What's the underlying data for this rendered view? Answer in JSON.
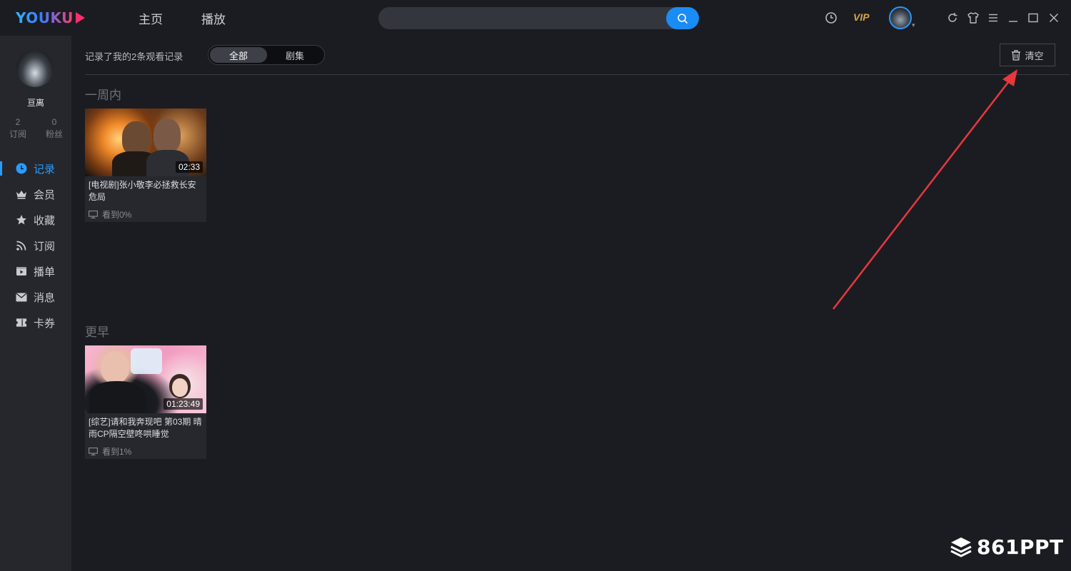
{
  "app": {
    "logo": "YOUKU"
  },
  "topbar": {
    "nav": [
      "主页",
      "播放"
    ],
    "search": {
      "placeholder": "",
      "value": ""
    },
    "vip_label": "VIP"
  },
  "sidebar": {
    "username": "亘离",
    "stats": [
      {
        "value": "2",
        "label": "订阅"
      },
      {
        "value": "0",
        "label": "粉丝"
      }
    ],
    "items": [
      {
        "label": "记录",
        "icon": "clock-icon",
        "active": true
      },
      {
        "label": "会员",
        "icon": "crown-icon"
      },
      {
        "label": "收藏",
        "icon": "star-icon"
      },
      {
        "label": "订阅",
        "icon": "rss-icon"
      },
      {
        "label": "播单",
        "icon": "playlist-icon"
      },
      {
        "label": "消息",
        "icon": "mail-icon"
      },
      {
        "label": "卡券",
        "icon": "ticket-icon"
      }
    ]
  },
  "main": {
    "summary": "记录了我的2条观看记录",
    "filter": {
      "all": "全部",
      "episodes": "剧集",
      "selected": "全部"
    },
    "clear_label": "清空",
    "sections": [
      {
        "title": "一周内",
        "items": [
          {
            "title": "[电视剧]张小敬李必拯救长安危局",
            "duration": "02:33",
            "progress": "看到0%"
          }
        ]
      },
      {
        "title": "更早",
        "items": [
          {
            "title": "[综艺]请和我奔现吧 第03期 晴雨CP隔空壁咚哄睡觉",
            "duration": "01:23:49",
            "progress": "看到1%"
          }
        ]
      }
    ]
  },
  "colors": {
    "accent": "#1a8cf5",
    "background": "#1b1c21",
    "sidebar": "#25272c",
    "vip": "#d8a54a",
    "annotation": "#e8383d"
  },
  "watermark": "861PPT"
}
